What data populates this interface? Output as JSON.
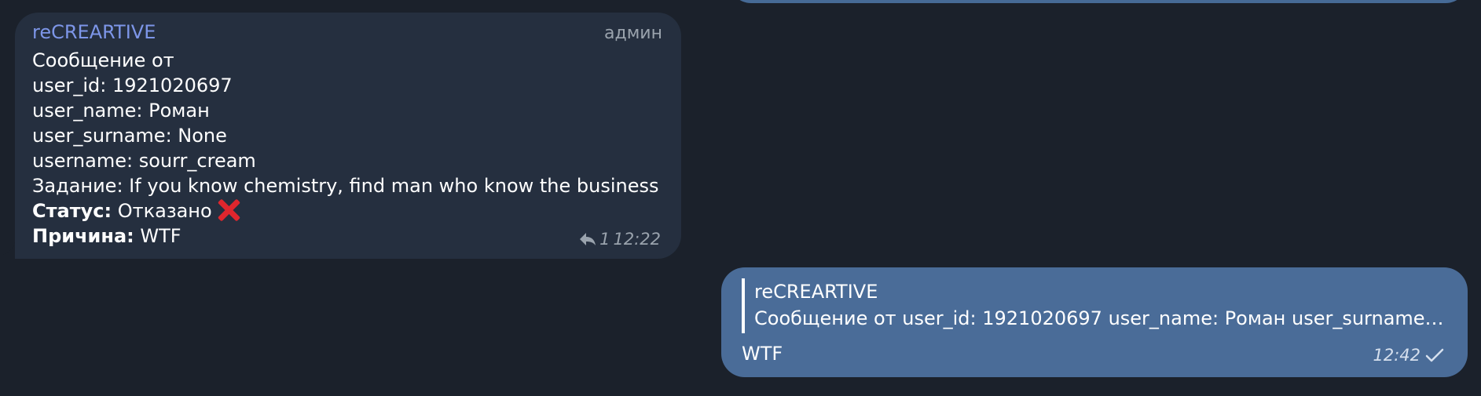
{
  "incoming_message": {
    "sender": "reCREARTIVE",
    "role": "админ",
    "lines": [
      "Сообщение от",
      "user_id: 1921020697",
      "user_name: Роман",
      "user_surname: None",
      "username: sourr_cream",
      "Задание: If you know chemistry, find man who know the business"
    ],
    "status_label": "Статус:",
    "status_value": " Отказано",
    "status_icon": "cross-mark-icon",
    "reason_label": "Причина:",
    "reason_value": " WTF",
    "reply_count": "1",
    "time": "12:22"
  },
  "outgoing_message": {
    "quote_author": "reCREARTIVE",
    "quote_text": "Сообщение от user_id: 1921020697 user_name: Роман user_surname:...",
    "text": "WTF",
    "time": "12:42",
    "status_icon": "single-check-icon"
  },
  "colors": {
    "background": "#1b212b",
    "incoming_bubble": "#252f3f",
    "outgoing_bubble": "#4a6c98",
    "sender_name": "#7d96e8",
    "cross": "#e0262d"
  }
}
